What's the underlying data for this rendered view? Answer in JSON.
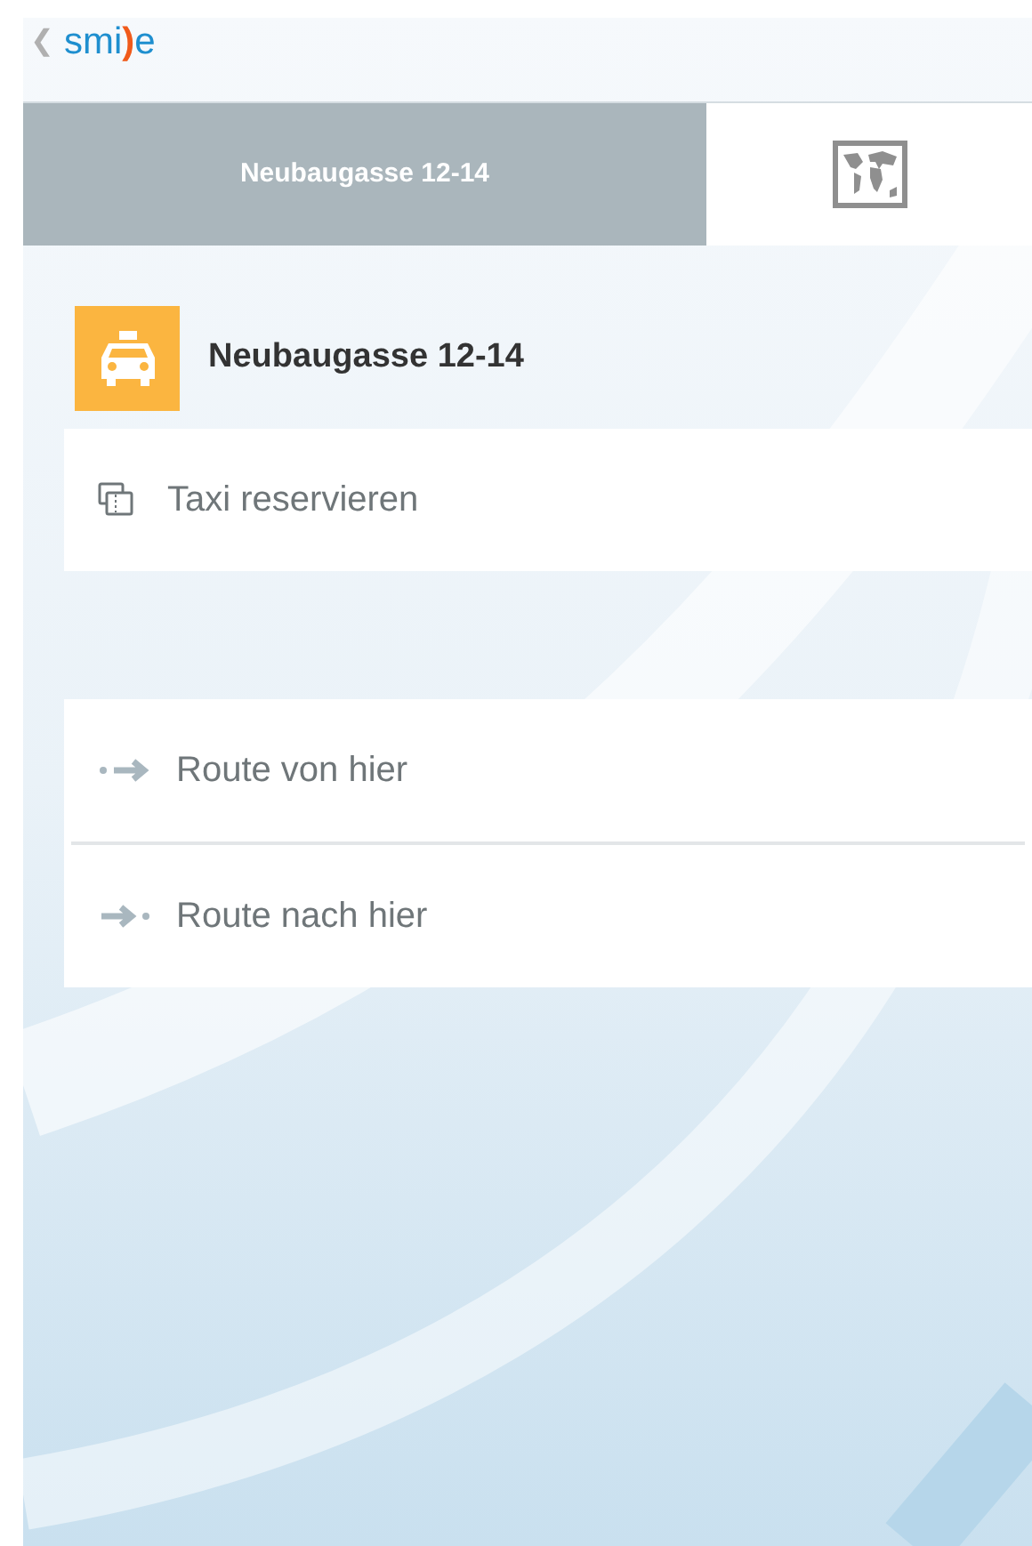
{
  "header": {
    "back_glyph": "❮",
    "logo": {
      "before": "smi",
      "mark": ")",
      "after": "e"
    }
  },
  "tabs": [
    {
      "kind": "text",
      "label": "Neubaugasse 12-14",
      "selected": true
    },
    {
      "kind": "map",
      "selected": false
    }
  ],
  "place": {
    "title": "Neubaugasse 12-14"
  },
  "actions": [
    {
      "kind": "reserve",
      "label": "Taxi reservieren"
    }
  ],
  "routes": [
    {
      "kind": "from",
      "label": "Route von hier"
    },
    {
      "kind": "to",
      "label": "Route nach hier"
    }
  ]
}
